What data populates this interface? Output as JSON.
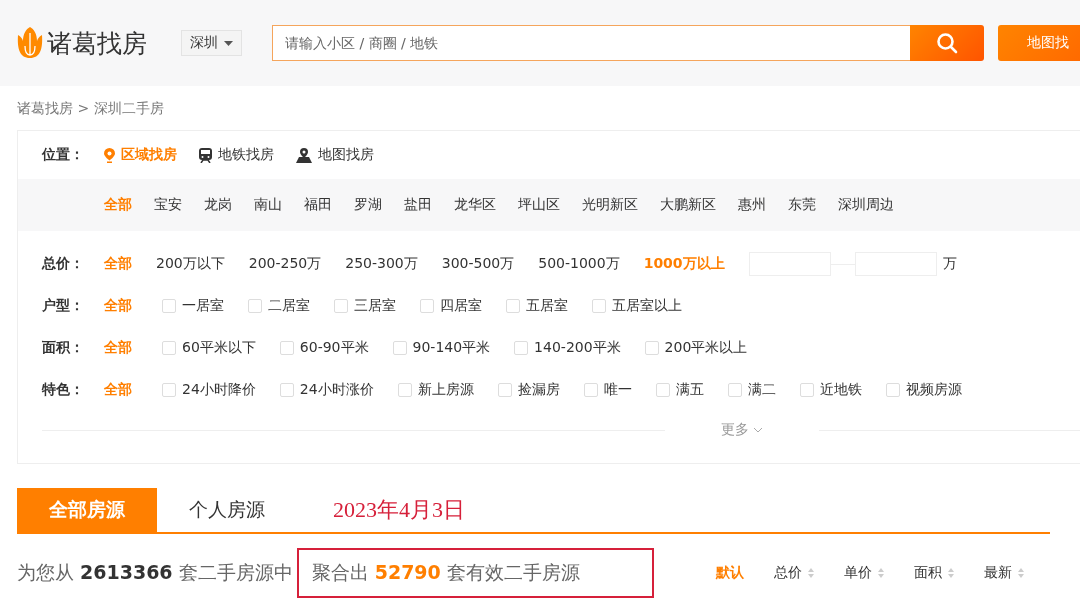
{
  "header": {
    "logo": "诸葛找房",
    "city": "深圳",
    "search": {
      "placeholder": "请输入小区 / 商圈 / 地铁"
    },
    "map_button": "地图找"
  },
  "breadcrumb": "诸葛找房 > 深圳二手房",
  "location": {
    "label": "位置：",
    "modes": [
      {
        "label": "区域找房",
        "kind": "pin",
        "selected": true
      },
      {
        "label": "地铁找房",
        "kind": "subway",
        "selected": false
      },
      {
        "label": "地图找房",
        "kind": "map",
        "selected": false
      }
    ]
  },
  "districts": [
    {
      "label": "全部",
      "selected": true
    },
    {
      "label": "宝安",
      "selected": false
    },
    {
      "label": "龙岗",
      "selected": false
    },
    {
      "label": "南山",
      "selected": false
    },
    {
      "label": "福田",
      "selected": false
    },
    {
      "label": "罗湖",
      "selected": false
    },
    {
      "label": "盐田",
      "selected": false
    },
    {
      "label": "龙华区",
      "selected": false
    },
    {
      "label": "坪山区",
      "selected": false
    },
    {
      "label": "光明新区",
      "selected": false
    },
    {
      "label": "大鹏新区",
      "selected": false
    },
    {
      "label": "惠州",
      "selected": false
    },
    {
      "label": "东莞",
      "selected": false
    },
    {
      "label": "深圳周边",
      "selected": false
    }
  ],
  "filters": [
    {
      "label": "总价：",
      "kind": "links",
      "all": {
        "label": "全部",
        "selected": true
      },
      "range_unit": "万",
      "options": [
        {
          "label": "200万以下",
          "selected": false
        },
        {
          "label": "200-250万",
          "selected": false
        },
        {
          "label": "250-300万",
          "selected": false
        },
        {
          "label": "300-500万",
          "selected": false
        },
        {
          "label": "500-1000万",
          "selected": false
        },
        {
          "label": "1000万以上",
          "selected": true
        }
      ]
    },
    {
      "label": "户型：",
      "kind": "checks",
      "all": {
        "label": "全部",
        "selected": true
      },
      "options": [
        {
          "label": "一居室",
          "checked": false
        },
        {
          "label": "二居室",
          "checked": false
        },
        {
          "label": "三居室",
          "checked": false
        },
        {
          "label": "四居室",
          "checked": false
        },
        {
          "label": "五居室",
          "checked": false
        },
        {
          "label": "五居室以上",
          "checked": false
        }
      ]
    },
    {
      "label": "面积：",
      "kind": "checks",
      "all": {
        "label": "全部",
        "selected": true
      },
      "options": [
        {
          "label": "60平米以下",
          "checked": false
        },
        {
          "label": "60-90平米",
          "checked": false
        },
        {
          "label": "90-140平米",
          "checked": false
        },
        {
          "label": "140-200平米",
          "checked": false
        },
        {
          "label": "200平米以上",
          "checked": false
        }
      ]
    },
    {
      "label": "特色：",
      "kind": "checks",
      "all": {
        "label": "全部",
        "selected": true
      },
      "options": [
        {
          "label": "24小时降价",
          "checked": false
        },
        {
          "label": "24小时涨价",
          "checked": false
        },
        {
          "label": "新上房源",
          "checked": false
        },
        {
          "label": "捡漏房",
          "checked": false
        },
        {
          "label": "唯一",
          "checked": false
        },
        {
          "label": "满五",
          "checked": false
        },
        {
          "label": "满二",
          "checked": false
        },
        {
          "label": "近地铁",
          "checked": false
        },
        {
          "label": "视频房源",
          "checked": false
        }
      ]
    }
  ],
  "more": "更多",
  "tabs": [
    {
      "label": "全部房源",
      "selected": true
    },
    {
      "label": "个人房源",
      "selected": false
    }
  ],
  "annotation_date": "2023年4月3日",
  "summary": {
    "text": "为您从 **2613366** 套二手房源中",
    "highlight": "聚合出 **52790** 套有效二手房源"
  },
  "sort": [
    {
      "label": "默认",
      "selected": true,
      "sortable": false
    },
    {
      "label": "总价",
      "selected": false,
      "sortable": true
    },
    {
      "label": "单价",
      "selected": false,
      "sortable": true
    },
    {
      "label": "面积",
      "selected": false,
      "sortable": true
    },
    {
      "label": "最新",
      "selected": false,
      "sortable": true
    }
  ]
}
